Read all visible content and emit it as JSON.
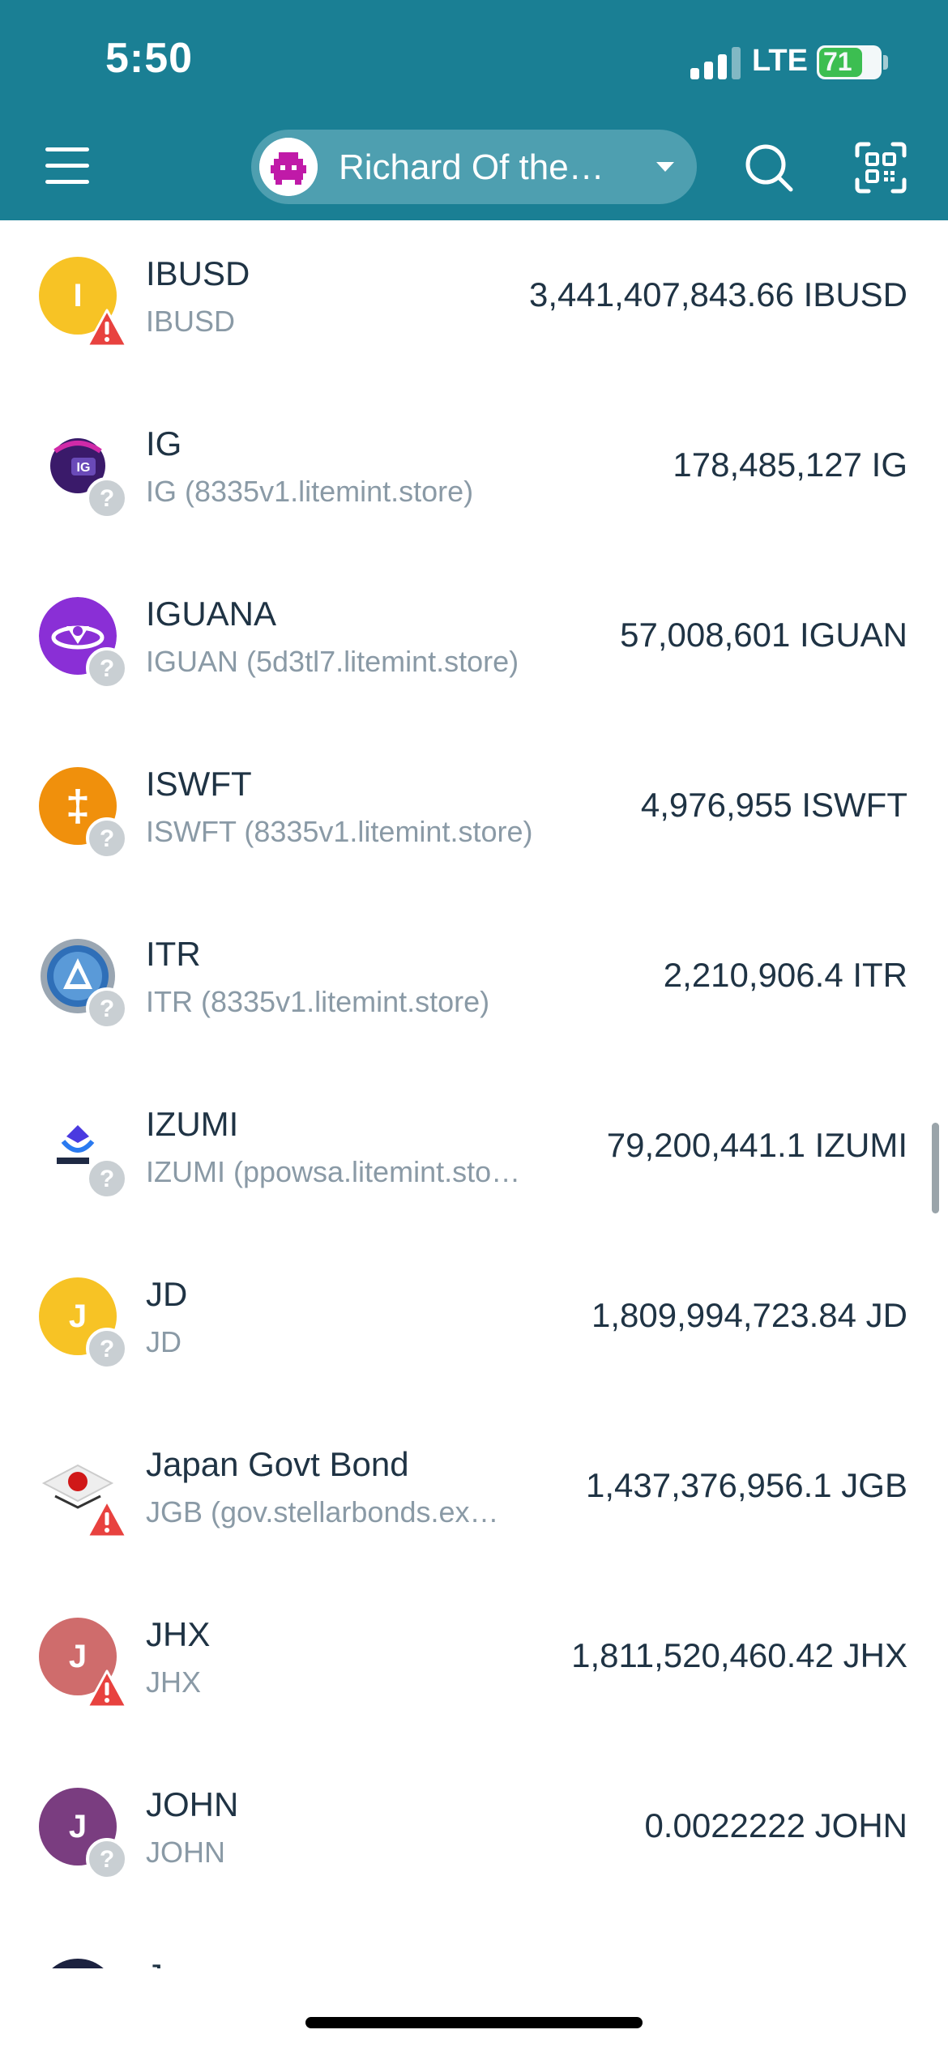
{
  "status_bar": {
    "time": "5:50",
    "network": "LTE",
    "battery": "71",
    "battery_level": 0.71
  },
  "header": {
    "account_name": "Richard Of the…",
    "menu_icon": "hamburger-menu-icon",
    "search_icon": "search-icon",
    "scan_icon": "qr-scan-icon"
  },
  "colors": {
    "header_bg": "#1a7f94",
    "warning": "#e8423f",
    "unknown_badge": "#c9cfd3"
  },
  "assets": [
    {
      "name": "IBUSD",
      "sub": "IBUSD",
      "amount": "3,441,407,843.66 IBUSD",
      "letter": "I",
      "icon_color": "#f7c325",
      "badge": "warning"
    },
    {
      "name": "IG",
      "sub": "IG (8335v1.litemint.store)",
      "amount": "178,485,127 IG",
      "letter": "IG",
      "icon_color": "#3a1a6a",
      "badge": "unknown"
    },
    {
      "name": "IGUANA",
      "sub": "IGUAN (5d3tl7.litemint.store)",
      "amount": "57,008,601 IGUAN",
      "letter": "",
      "icon_color": "#8a2fd6",
      "badge": "unknown"
    },
    {
      "name": "ISWFT",
      "sub": "ISWFT (8335v1.litemint.store)",
      "amount": "4,976,955 ISWFT",
      "letter": "‡",
      "icon_color": "#f0900c",
      "badge": "unknown"
    },
    {
      "name": "ITR",
      "sub": "ITR (8335v1.litemint.store)",
      "amount": "2,210,906.4 ITR",
      "letter": "",
      "icon_color": "#6f8aa8",
      "badge": "unknown"
    },
    {
      "name": "IZUMI",
      "sub": "IZUMI (ppowsa.litemint.sto…",
      "amount": "79,200,441.1 IZUMI",
      "letter": "",
      "icon_color": "#ffffff",
      "badge": "unknown"
    },
    {
      "name": "JD",
      "sub": "JD",
      "amount": "1,809,994,723.84 JD",
      "letter": "J",
      "icon_color": "#f7c325",
      "badge": "unknown"
    },
    {
      "name": "Japan Govt Bond",
      "sub": "JGB (gov.stellarbonds.ex…",
      "amount": "1,437,376,956.1 JGB",
      "letter": "",
      "icon_color": "#ffffff",
      "badge": "warning"
    },
    {
      "name": "JHX",
      "sub": "JHX",
      "amount": "1,811,520,460.42 JHX",
      "letter": "J",
      "icon_color": "#cf6c6c",
      "badge": "warning"
    },
    {
      "name": "JOHN",
      "sub": "JOHN",
      "amount": "0.0022222 JOHN",
      "letter": "J",
      "icon_color": "#7a3d80",
      "badge": "unknown"
    }
  ],
  "partial_row_name": "J"
}
